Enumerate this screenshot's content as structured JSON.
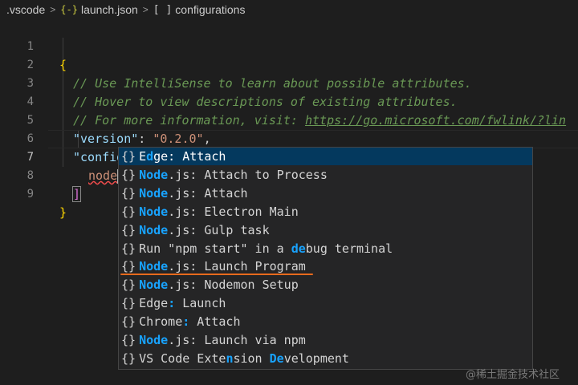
{
  "breadcrumb": {
    "folder": ".vscode",
    "file": "launch.json",
    "node": "configurations",
    "sep": ">",
    "json_icon": "{-}",
    "array_icon": "[ ]"
  },
  "editor": {
    "line_numbers": [
      "1",
      "2",
      "3",
      "4",
      "5",
      "6",
      "7",
      "8",
      "9"
    ],
    "comment1": "// Use IntelliSense to learn about possible attributes.",
    "comment2": "// Hover to view descriptions of existing attributes.",
    "comment3_prefix": "// For more information, visit: ",
    "comment3_link": "https://go.microsoft.com/fwlink/?lin",
    "version_key": "\"version\"",
    "version_value": "\"0.2.0\"",
    "configurations_key": "\"configurations\"",
    "typed": "node",
    "open_brace": "{",
    "close_brace": "}",
    "open_bracket": "[",
    "close_bracket": "]"
  },
  "suggestions": [
    {
      "icon": "{}",
      "parts": [
        [
          "",
          ""
        ],
        [
          "E",
          ""
        ],
        [
          "d",
          "hl"
        ],
        [
          "",
          ""
        ],
        [
          "ge: Attach",
          ""
        ]
      ]
    },
    {
      "icon": "{}",
      "parts": [
        [
          "Node",
          "hl"
        ],
        [
          ".js: Attach to Process",
          ""
        ]
      ]
    },
    {
      "icon": "{}",
      "parts": [
        [
          "Node",
          "hl"
        ],
        [
          ".js: Attach",
          ""
        ]
      ]
    },
    {
      "icon": "{}",
      "parts": [
        [
          "Node",
          "hl"
        ],
        [
          ".js: Electron Main",
          ""
        ]
      ]
    },
    {
      "icon": "{}",
      "parts": [
        [
          "Node",
          "hl"
        ],
        [
          ".js: Gulp task",
          ""
        ]
      ]
    },
    {
      "icon": "{}",
      "parts": [
        [
          "Run \"npm start\" in a ",
          ""
        ],
        [
          "de",
          "hl"
        ],
        [
          "bug terminal",
          ""
        ]
      ]
    },
    {
      "icon": "{}",
      "parts": [
        [
          "Node",
          "hl"
        ],
        [
          ".js: Launch Program",
          ""
        ]
      ]
    },
    {
      "icon": "{}",
      "parts": [
        [
          "Node",
          "hl"
        ],
        [
          ".js: Nodemon Setup",
          ""
        ]
      ]
    },
    {
      "icon": "{}",
      "parts": [
        [
          "Edge",
          ""
        ],
        [
          ":",
          "hl"
        ],
        [
          " Launch",
          ""
        ]
      ]
    },
    {
      "icon": "{}",
      "parts": [
        [
          "Chrome",
          ""
        ],
        [
          ":",
          "hl"
        ],
        [
          " Attach",
          ""
        ]
      ]
    },
    {
      "icon": "{}",
      "parts": [
        [
          "Node",
          "hl"
        ],
        [
          ".js: Launch via npm",
          ""
        ]
      ]
    },
    {
      "icon": "{}",
      "parts": [
        [
          "VS Code Exte",
          ""
        ],
        [
          "n",
          "hl"
        ],
        [
          "sion ",
          ""
        ],
        [
          "De",
          "hl"
        ],
        [
          "velopment",
          ""
        ]
      ]
    }
  ],
  "watermark": "@稀土掘金技术社区",
  "colors": {
    "highlight": "#18a3ff",
    "selection": "#04395e",
    "annotation": "#e86a1d"
  }
}
